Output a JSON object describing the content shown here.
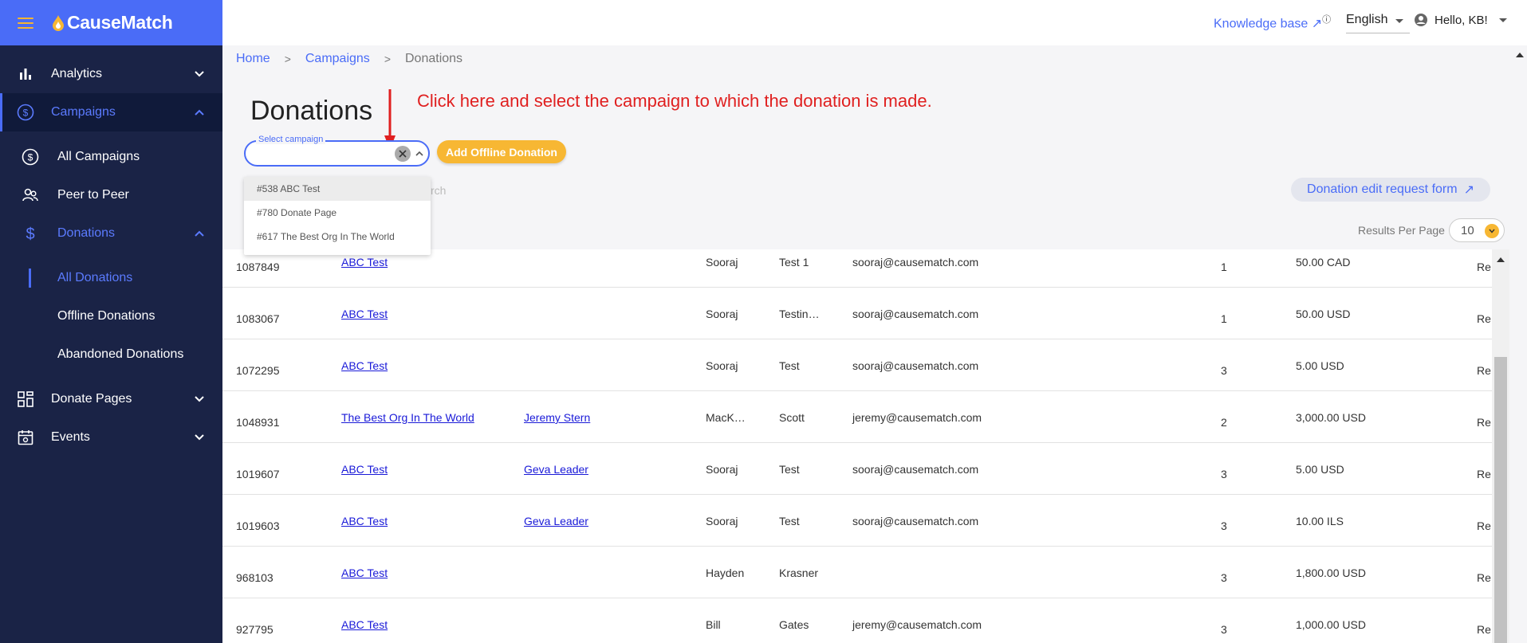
{
  "app": {
    "name": "CauseMatch"
  },
  "sidebar": {
    "items": [
      {
        "label": "Analytics",
        "icon": "bar-chart-icon"
      },
      {
        "label": "Campaigns",
        "icon": "dollar-circle-icon"
      },
      {
        "label": "All Campaigns",
        "icon": "dollar-circle-icon"
      },
      {
        "label": "Peer to Peer",
        "icon": "users-icon"
      },
      {
        "label": "Donations",
        "icon": "dollar-icon"
      },
      {
        "label": "All Donations"
      },
      {
        "label": "Offline Donations"
      },
      {
        "label": "Abandoned Donations"
      },
      {
        "label": "Donate Pages",
        "icon": "grid-icon"
      },
      {
        "label": "Events",
        "icon": "calendar-icon"
      }
    ]
  },
  "header": {
    "knowledge_base": "Knowledge base",
    "language": "English",
    "greeting": "Hello, KB!"
  },
  "breadcrumb": [
    "Home",
    "Campaigns",
    "Donations"
  ],
  "page": {
    "title": "Donations",
    "annotation": "Click here and select the campaign to which the donation is made.",
    "select_label": "Select campaign",
    "add_offline": "Add Offline Donation",
    "search_fragment": "rch",
    "edit_request": "Donation edit request form",
    "results_per_page_label": "Results Per Page",
    "results_per_page": "10"
  },
  "dropdown": {
    "options": [
      "#538 ABC Test",
      "#780 Donate Page",
      "#617 The Best Org In The World"
    ]
  },
  "rows": [
    {
      "id": "1087849",
      "campaign": "ABC Test",
      "team": "",
      "first": "Sooraj",
      "last": "Test 1",
      "email": "sooraj@causematch.com",
      "count": "1",
      "amount": "50.00 CAD",
      "status": "Re"
    },
    {
      "id": "1083067",
      "campaign": "ABC Test",
      "team": "",
      "first": "Sooraj",
      "last": "Testin…",
      "email": "sooraj@causematch.com",
      "count": "1",
      "amount": "50.00 USD",
      "status": "Re"
    },
    {
      "id": "1072295",
      "campaign": "ABC Test",
      "team": "",
      "first": "Sooraj",
      "last": "Test",
      "email": "sooraj@causematch.com",
      "count": "3",
      "amount": "5.00 USD",
      "status": "Re"
    },
    {
      "id": "1048931",
      "campaign": "The Best Org In The World",
      "team": "Jeremy Stern",
      "first": "MacK…",
      "last": "Scott",
      "email": "jeremy@causematch.com",
      "count": "2",
      "amount": "3,000.00 USD",
      "status": "Re"
    },
    {
      "id": "1019607",
      "campaign": "ABC Test",
      "team": "Geva Leader",
      "first": "Sooraj",
      "last": "Test",
      "email": "sooraj@causematch.com",
      "count": "3",
      "amount": "5.00 USD",
      "status": "Re"
    },
    {
      "id": "1019603",
      "campaign": "ABC Test",
      "team": "Geva Leader",
      "first": "Sooraj",
      "last": "Test",
      "email": "sooraj@causematch.com",
      "count": "3",
      "amount": "10.00 ILS",
      "status": "Re"
    },
    {
      "id": "968103",
      "campaign": "ABC Test",
      "team": "",
      "first": "Hayden",
      "last": "Krasner",
      "email": "",
      "count": "3",
      "amount": "1,800.00 USD",
      "status": "Re"
    },
    {
      "id": "927795",
      "campaign": "ABC Test",
      "team": "",
      "first": "Bill",
      "last": "Gates",
      "email": "jeremy@causematch.com",
      "count": "3",
      "amount": "1,000.00 USD",
      "status": "Re"
    }
  ]
}
